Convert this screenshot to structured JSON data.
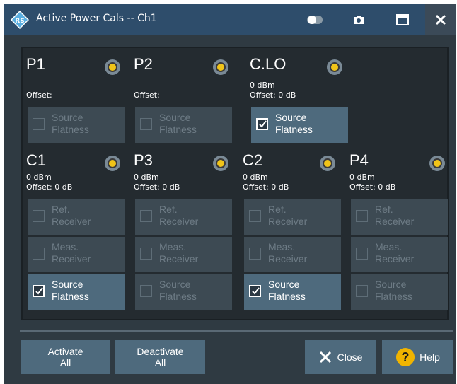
{
  "window": {
    "title": "Active Power Cals -- Ch1"
  },
  "panels_top": [
    {
      "name": "P1",
      "power": "",
      "offset": "Offset:",
      "source_flatness": {
        "label1": "Source",
        "label2": "Flatness",
        "checked": false
      }
    },
    {
      "name": "P2",
      "power": "",
      "offset": "Offset:",
      "source_flatness": {
        "label1": "Source",
        "label2": "Flatness",
        "checked": false
      }
    },
    {
      "name": "C.LO",
      "power": "0 dBm",
      "offset": "Offset: 0 dB",
      "source_flatness": {
        "label1": "Source",
        "label2": "Flatness",
        "checked": true
      }
    }
  ],
  "panels_bottom": [
    {
      "name": "C1",
      "power": "0 dBm",
      "offset": "Offset: 0 dB",
      "ref": {
        "label1": "Ref.",
        "label2": "Receiver"
      },
      "meas": {
        "label1": "Meas.",
        "label2": "Receiver"
      },
      "source_flatness": {
        "label1": "Source",
        "label2": "Flatness",
        "checked": true
      }
    },
    {
      "name": "P3",
      "power": "0 dBm",
      "offset": "Offset: 0 dB",
      "ref": {
        "label1": "Ref.",
        "label2": "Receiver"
      },
      "meas": {
        "label1": "Meas.",
        "label2": "Receiver"
      },
      "source_flatness": {
        "label1": "Source",
        "label2": "Flatness",
        "checked": false
      }
    },
    {
      "name": "C2",
      "power": "0 dBm",
      "offset": "Offset: 0 dB",
      "ref": {
        "label1": "Ref.",
        "label2": "Receiver"
      },
      "meas": {
        "label1": "Meas.",
        "label2": "Receiver"
      },
      "source_flatness": {
        "label1": "Source",
        "label2": "Flatness",
        "checked": true
      }
    },
    {
      "name": "P4",
      "power": "0 dBm",
      "offset": "Offset: 0 dB",
      "ref": {
        "label1": "Ref.",
        "label2": "Receiver"
      },
      "meas": {
        "label1": "Meas.",
        "label2": "Receiver"
      },
      "source_flatness": {
        "label1": "Source",
        "label2": "Flatness",
        "checked": false
      }
    }
  ],
  "footer": {
    "activate_all_1": "Activate",
    "activate_all_2": "All",
    "deactivate_all_1": "Deactivate",
    "deactivate_all_2": "All",
    "close": "Close",
    "help": "Help"
  },
  "icons": {
    "logo": "rohde-schwarz-logo",
    "toggle": "toggle-icon",
    "camera": "camera-icon",
    "maximize": "maximize-icon",
    "close": "close-icon",
    "help": "question-icon"
  },
  "colors": {
    "titlebar": "#2e4d6b",
    "background": "#2f3a42",
    "button_active": "#4e6a7d",
    "button_inactive": "#3d4a53",
    "radio_dot": "#f0c419",
    "help_icon": "#f0b400"
  }
}
